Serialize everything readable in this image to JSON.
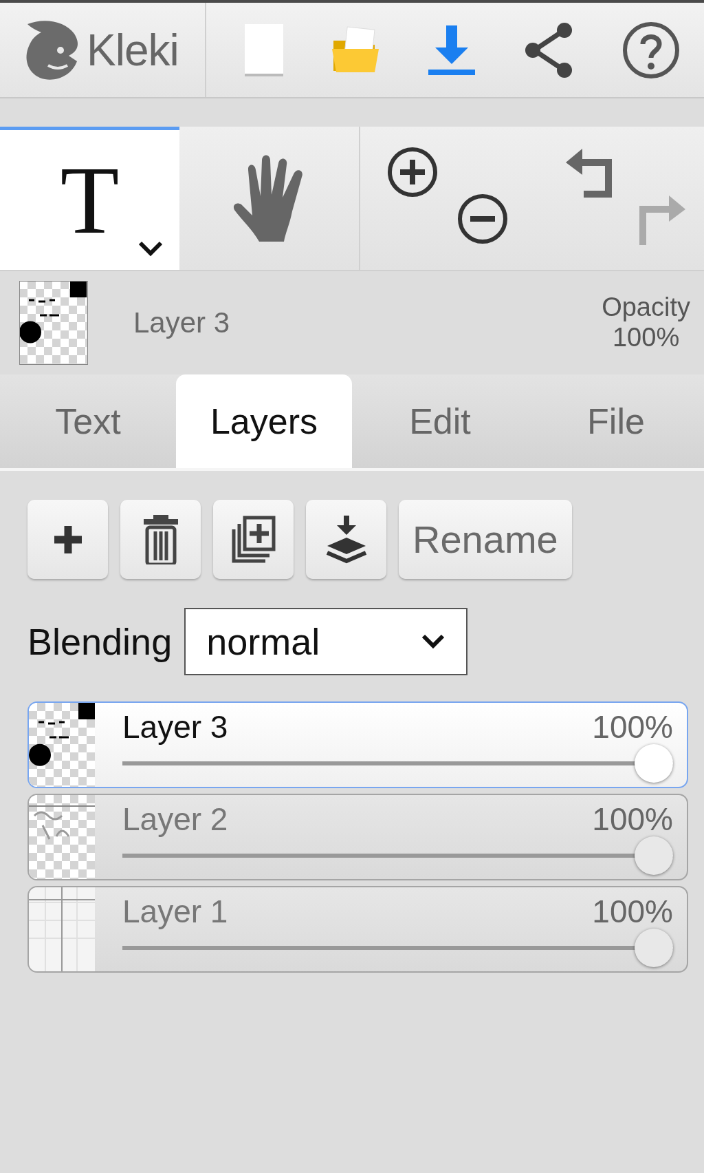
{
  "app": {
    "logo": "Kleki"
  },
  "tools": [
    {
      "kind": "text",
      "label": "T",
      "selected": true
    },
    {
      "kind": "hand",
      "selected": false
    }
  ],
  "history": [
    {
      "kind": "undo",
      "disabled": false
    },
    {
      "kind": "redo",
      "disabled": true
    }
  ],
  "layer_header": {
    "name": "Layer 3",
    "opacity_label": "Opacity",
    "opacity_value": "100%"
  },
  "tabs": [
    {
      "label": "Text",
      "selected": false
    },
    {
      "label": "Layers",
      "selected": true
    },
    {
      "label": "Edit",
      "selected": false
    },
    {
      "label": "File",
      "selected": false
    }
  ],
  "layer_buttons": [
    {
      "kind": "add"
    },
    {
      "kind": "delete"
    },
    {
      "kind": "duplicate"
    },
    {
      "kind": "merge"
    },
    {
      "kind": "rename",
      "label": "Rename"
    }
  ],
  "blending": {
    "label": "Blending",
    "value": "normal"
  },
  "layers": [
    {
      "name": "Layer 3",
      "opacity": "100%",
      "level": 1,
      "selected": true,
      "kind": "dots"
    },
    {
      "name": "Layer 2",
      "opacity": "100%",
      "level": 1,
      "selected": false,
      "kind": "scribble"
    },
    {
      "name": "Layer 1",
      "opacity": "100%",
      "level": 1,
      "selected": false,
      "kind": "grid"
    }
  ]
}
